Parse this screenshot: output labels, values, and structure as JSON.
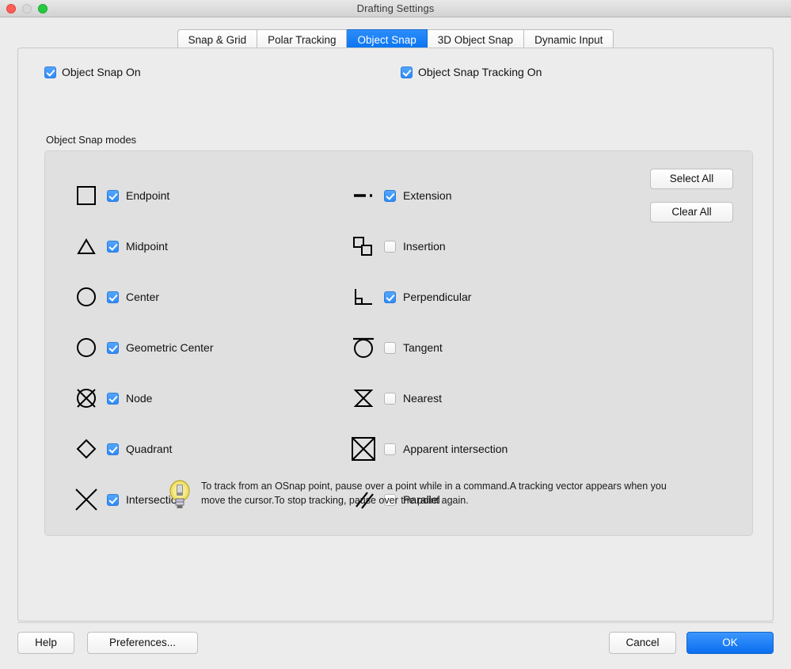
{
  "window": {
    "title": "Drafting Settings",
    "controls": [
      {
        "name": "close",
        "color": "#ff5f57"
      },
      {
        "name": "minimize",
        "color": "#d9d9d9"
      },
      {
        "name": "zoom",
        "color": "#28c840"
      }
    ]
  },
  "tabs": [
    {
      "label": "Snap & Grid",
      "active": false
    },
    {
      "label": "Polar Tracking",
      "active": false
    },
    {
      "label": "Object Snap",
      "active": true
    },
    {
      "label": "3D Object Snap",
      "active": false
    },
    {
      "label": "Dynamic Input",
      "active": false
    }
  ],
  "toggles": {
    "object_snap_on": {
      "label": "Object Snap On",
      "checked": true
    },
    "object_snap_tracking_on": {
      "label": "Object Snap Tracking On",
      "checked": true
    }
  },
  "group": {
    "title": "Object Snap modes",
    "left_column": [
      {
        "label": "Endpoint",
        "checked": true,
        "icon": "square-icon"
      },
      {
        "label": "Midpoint",
        "checked": true,
        "icon": "triangle-icon"
      },
      {
        "label": "Center",
        "checked": true,
        "icon": "circle-icon"
      },
      {
        "label": "Geometric Center",
        "checked": true,
        "icon": "circle-icon"
      },
      {
        "label": "Node",
        "checked": true,
        "icon": "circle-x-icon"
      },
      {
        "label": "Quadrant",
        "checked": true,
        "icon": "diamond-icon"
      },
      {
        "label": "Intersection",
        "checked": true,
        "icon": "x-cross-icon"
      }
    ],
    "right_column": [
      {
        "label": "Extension",
        "checked": true,
        "icon": "dashed-line-icon"
      },
      {
        "label": "Insertion",
        "checked": false,
        "icon": "overlapping-squares-icon"
      },
      {
        "label": "Perpendicular",
        "checked": true,
        "icon": "right-angle-icon"
      },
      {
        "label": "Tangent",
        "checked": false,
        "icon": "circle-tangent-icon"
      },
      {
        "label": "Nearest",
        "checked": false,
        "icon": "hourglass-icon"
      },
      {
        "label": "Apparent intersection",
        "checked": false,
        "icon": "boxed-x-icon"
      },
      {
        "label": "Parallel",
        "checked": false,
        "icon": "parallel-lines-icon"
      }
    ],
    "select_all_label": "Select All",
    "clear_all_label": "Clear All"
  },
  "tip": {
    "icon": "lightbulb-icon",
    "text": "To track from an OSnap point, pause over a point while in a command.A tracking vector appears when you move the cursor.To stop tracking, pause over the point again."
  },
  "footer": {
    "help_label": "Help",
    "preferences_label": "Preferences...",
    "cancel_label": "Cancel",
    "ok_label": "OK"
  },
  "colors": {
    "accent": "#0a74f0",
    "window_bg": "#ececec",
    "group_bg": "#e0e0e0",
    "checkbox_on": "#2f8bf7",
    "tip_bulb": "#e8d44d"
  }
}
